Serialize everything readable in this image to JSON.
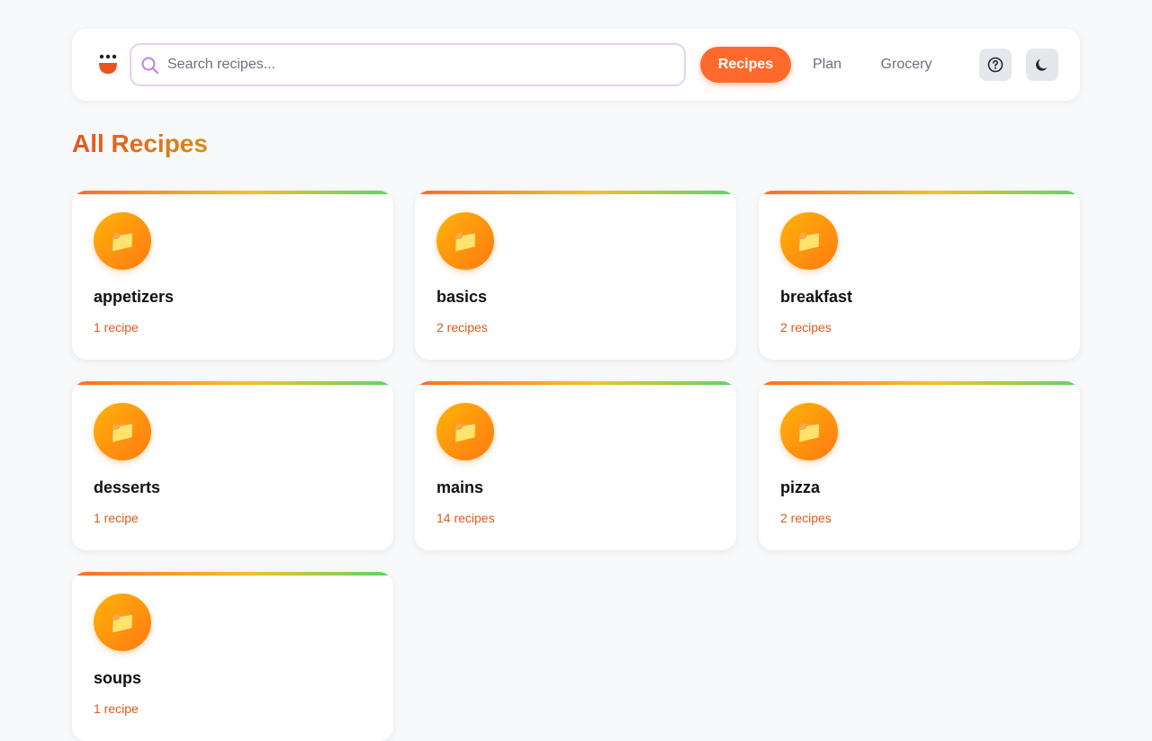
{
  "header": {
    "search_placeholder": "Search recipes...",
    "search_value": "",
    "nav": {
      "recipes": "Recipes",
      "plan": "Plan",
      "grocery": "Grocery"
    },
    "icons": {
      "logo": "chef-logo-icon",
      "search": "search-icon",
      "help": "help-icon",
      "theme": "moon-icon"
    }
  },
  "page": {
    "title": "All Recipes"
  },
  "categories": [
    {
      "name": "appetizers",
      "count": "1 recipe",
      "icon": "📁"
    },
    {
      "name": "basics",
      "count": "2 recipes",
      "icon": "📁"
    },
    {
      "name": "breakfast",
      "count": "2 recipes",
      "icon": "📁"
    },
    {
      "name": "desserts",
      "count": "1 recipe",
      "icon": "📁"
    },
    {
      "name": "mains",
      "count": "14 recipes",
      "icon": "📁"
    },
    {
      "name": "pizza",
      "count": "2 recipes",
      "icon": "📁"
    },
    {
      "name": "soups",
      "count": "1 recipe",
      "icon": "📁"
    }
  ],
  "colors": {
    "accent": "#ff6a2c",
    "count_text": "#e05a1a",
    "background": "#f8f9fb"
  }
}
